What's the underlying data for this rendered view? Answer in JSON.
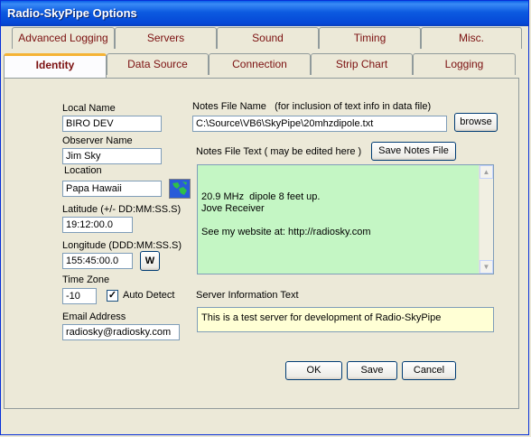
{
  "window": {
    "title": "Radio-SkyPipe Options"
  },
  "tabs_back": [
    "Advanced Logging",
    "Servers",
    "Sound",
    "Timing",
    "Misc."
  ],
  "tabs_front": [
    "Identity",
    "Data Source",
    "Connection",
    "Strip Chart",
    "Logging"
  ],
  "identity": {
    "local_name_label": "Local Name",
    "local_name_value": "BIRO DEV",
    "observer_name_label": "Observer Name",
    "observer_name_value": "Jim Sky",
    "location_label": "Location",
    "location_value": "Papa Hawaii",
    "latitude_label": "Latitude (+/- DD:MM:SS.S)",
    "latitude_value": "19:12:00.0",
    "longitude_label": "Longitude (DDD:MM:SS.S)",
    "longitude_value": "155:45:00.0",
    "longitude_dir_label": "W",
    "timezone_label": "Time Zone",
    "timezone_value": "-10",
    "auto_detect_label": "Auto Detect",
    "auto_detect_checked": true,
    "email_label": "Email Address",
    "email_value": "radiosky@radiosky.com"
  },
  "notes": {
    "file_name_label": "Notes File Name",
    "file_name_hint": "(for inclusion of text info in data file)",
    "file_name_value": "C:\\Source\\VB6\\SkyPipe\\20mhzdipole.txt",
    "browse_label": "browse",
    "text_label": "Notes File Text  ( may be edited here )",
    "save_notes_label": "Save Notes File",
    "text_value": "20.9 MHz  dipole 8 feet up.\nJove Receiver\n\nSee my website at: http://radiosky.com",
    "bg_color": "#c4f6c4"
  },
  "server": {
    "info_label": "Server Information Text",
    "info_value": "This is a test server for development of Radio-SkyPipe",
    "bg_color": "#ffffd5"
  },
  "buttons": {
    "ok": "OK",
    "save": "Save",
    "cancel": "Cancel"
  }
}
